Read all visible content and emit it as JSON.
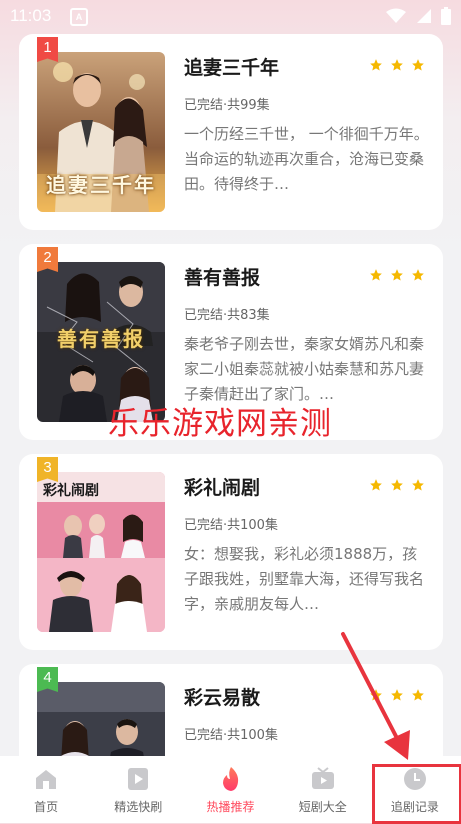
{
  "status_bar": {
    "time": "11:03",
    "notification_glyph": "A"
  },
  "dramas": [
    {
      "rank": "1",
      "rank_color": "#f04a44",
      "title": "追妻三千年",
      "poster_text": "追妻三千年",
      "meta": "已完结·共99集",
      "description": "一个历经三千世， 一个徘徊千万年。 当命运的轨迹再次重合，沧海已变桑田。待得终于…",
      "stars": 3
    },
    {
      "rank": "2",
      "rank_color": "#f07a3c",
      "title": "善有善报",
      "poster_text": "善有善报",
      "meta": "已完结·共83集",
      "description": "秦老爷子刚去世，秦家女婿苏凡和秦家二小姐秦蕊就被小姑秦慧和苏凡妻子秦倩赶出了家门。…",
      "stars": 3
    },
    {
      "rank": "3",
      "rank_color": "#f0b428",
      "title": "彩礼闹剧",
      "poster_text": "彩礼闹剧",
      "meta": "已完结·共100集",
      "description": "女：想娶我，彩礼必须1888万，孩子跟我姓，别墅靠大海，还得写我名字，亲戚朋友每人…",
      "stars": 3
    },
    {
      "rank": "4",
      "rank_color": "#4cba52",
      "title": "彩云易散",
      "poster_text": "",
      "meta": "已完结·共100集",
      "description": "",
      "stars": 3
    }
  ],
  "watermark": "乐乐游戏网亲测",
  "tabs": [
    {
      "label": "首页",
      "icon": "home-icon"
    },
    {
      "label": "精选快刷",
      "icon": "play-card-icon"
    },
    {
      "label": "热播推荐",
      "icon": "flame-icon",
      "active": true
    },
    {
      "label": "短剧大全",
      "icon": "tv-icon"
    },
    {
      "label": "追剧记录",
      "icon": "clock-icon"
    }
  ],
  "colors": {
    "accent": "#ff4a5d",
    "star": "#f5b800",
    "annotation": "#e8343e"
  }
}
